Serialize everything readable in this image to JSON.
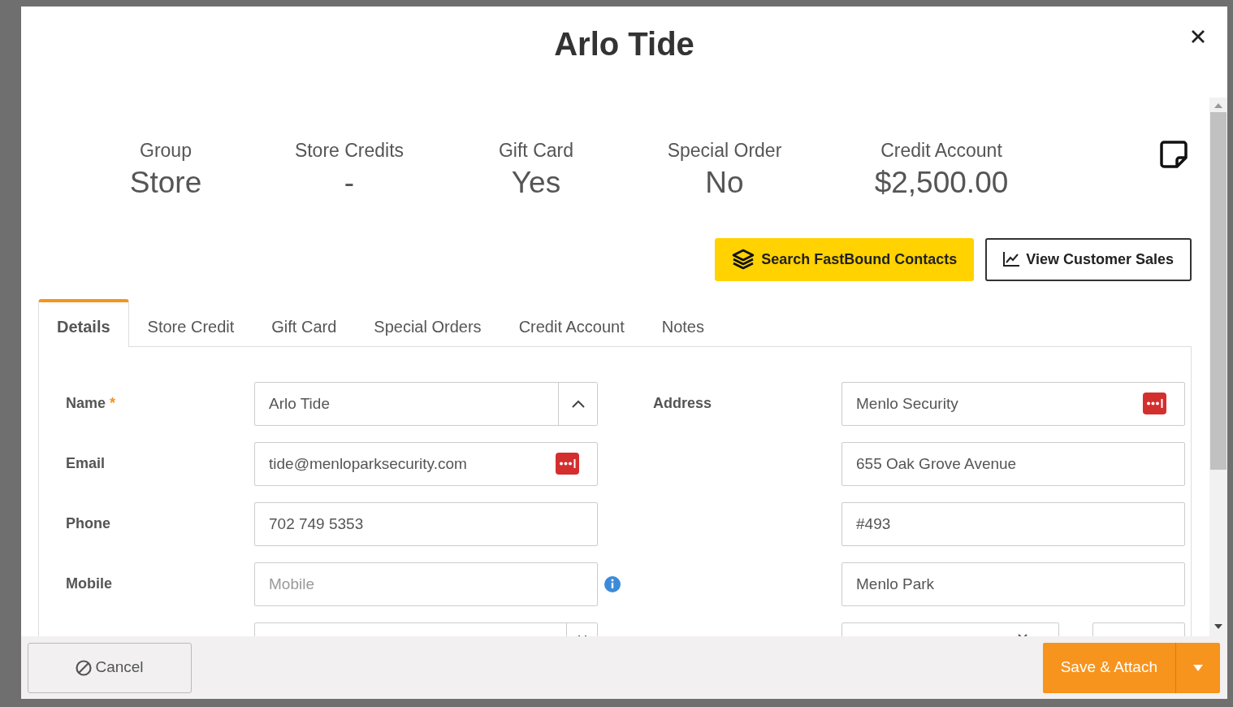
{
  "dialog": {
    "title": "Arlo Tide"
  },
  "stats": [
    {
      "label": "Group",
      "value": "Store"
    },
    {
      "label": "Store Credits",
      "value": "-"
    },
    {
      "label": "Gift Card",
      "value": "Yes"
    },
    {
      "label": "Special Order",
      "value": "No"
    },
    {
      "label": "Credit Account",
      "value": "$2,500.00"
    }
  ],
  "actions": [
    {
      "label": "Search FastBound Contacts",
      "kind": "primary"
    },
    {
      "label": "View Customer Sales",
      "kind": "outline"
    }
  ],
  "tabs": [
    {
      "label": "Details",
      "selected": true
    },
    {
      "label": "Store Credit",
      "selected": false
    },
    {
      "label": "Gift Card",
      "selected": false
    },
    {
      "label": "Special Orders",
      "selected": false
    },
    {
      "label": "Credit Account",
      "selected": false
    },
    {
      "label": "Notes",
      "selected": false
    }
  ],
  "form_left": [
    {
      "label": "Name",
      "required_mark": "*",
      "value": "Arlo Tide",
      "kind": "collapse"
    },
    {
      "label": "Email",
      "value": "tide@menloparksecurity.com",
      "kind": "password-manager"
    },
    {
      "label": "Phone",
      "value": "702 749 5353",
      "kind": "text"
    },
    {
      "label": "Mobile",
      "placeholder": "Mobile",
      "kind": "info"
    },
    {
      "kind": "date"
    }
  ],
  "address": {
    "label": "Address",
    "lines": [
      {
        "value": "Menlo Security",
        "kind": "password-manager"
      },
      {
        "value": "655 Oak Grove Avenue",
        "kind": "text"
      },
      {
        "value": "#493",
        "kind": "text"
      },
      {
        "value": "Menlo Park",
        "kind": "text"
      },
      {
        "kind": "state-zip"
      }
    ]
  },
  "footer": {
    "cancel": "Cancel",
    "save": "Save & Attach"
  }
}
